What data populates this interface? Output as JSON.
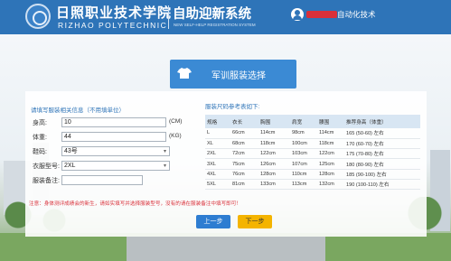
{
  "header": {
    "school_name_cn": "日照职业技术学院",
    "school_name_en": "RIZHAO POLYTECHNIC",
    "system_title_cn": "自助迎新系统",
    "system_title_en": "NEW SELF-HELP REGISTRATION SYSTEM",
    "user_name": "自动化技术"
  },
  "banner": {
    "title": "军训服装选择",
    "icon": "tshirt-icon"
  },
  "form": {
    "hint": "请填写服装相关信息（不用填单位）",
    "height": {
      "label": "身高:",
      "value": "10",
      "unit": "(CM)"
    },
    "weight": {
      "label": "体重:",
      "value": "44",
      "unit": "(KG)"
    },
    "shoe_size": {
      "label": "鞋码:",
      "value": "43号"
    },
    "clothing_size": {
      "label": "衣服型号:",
      "value": "2XL"
    },
    "remark": {
      "label": "服装备注:",
      "value": ""
    }
  },
  "size_chart": {
    "title": "服装尺码参考表如下:",
    "headers": [
      "规格",
      "衣长",
      "胸围",
      "肩宽",
      "袖长",
      "腰围",
      "推荐身高（体重）"
    ],
    "rows": [
      [
        "L",
        "66cm",
        "114cm",
        "98cm",
        "114cm",
        "165 (50-60) 左右"
      ],
      [
        "XL",
        "68cm",
        "118cm",
        "100cm",
        "118cm",
        "170 (60-70) 左右"
      ],
      [
        "2XL",
        "72cm",
        "122cm",
        "103cm",
        "122cm",
        "175 (70-80) 左右"
      ],
      [
        "3XL",
        "75cm",
        "126cm",
        "107cm",
        "125cm",
        "180 (80-90) 左右"
      ],
      [
        "4XL",
        "76cm",
        "128cm",
        "110cm",
        "128cm",
        "185 (90-100) 左右"
      ],
      [
        "5XL",
        "81cm",
        "133cm",
        "113cm",
        "132cm",
        "190 (100-110) 左右"
      ]
    ]
  },
  "notice": "注意：身体测评成绩会的新生，请如实填写并选择服装型号，没有的请在服装备注中填写即可！",
  "buttons": {
    "prev": "上一步",
    "next": "下一步"
  },
  "colors": {
    "header_bg": "#2e74b8",
    "banner_bg": "#3b8ad4",
    "prev_btn": "#2e7dd1",
    "next_btn": "#f4b400",
    "notice": "#d9303a"
  }
}
